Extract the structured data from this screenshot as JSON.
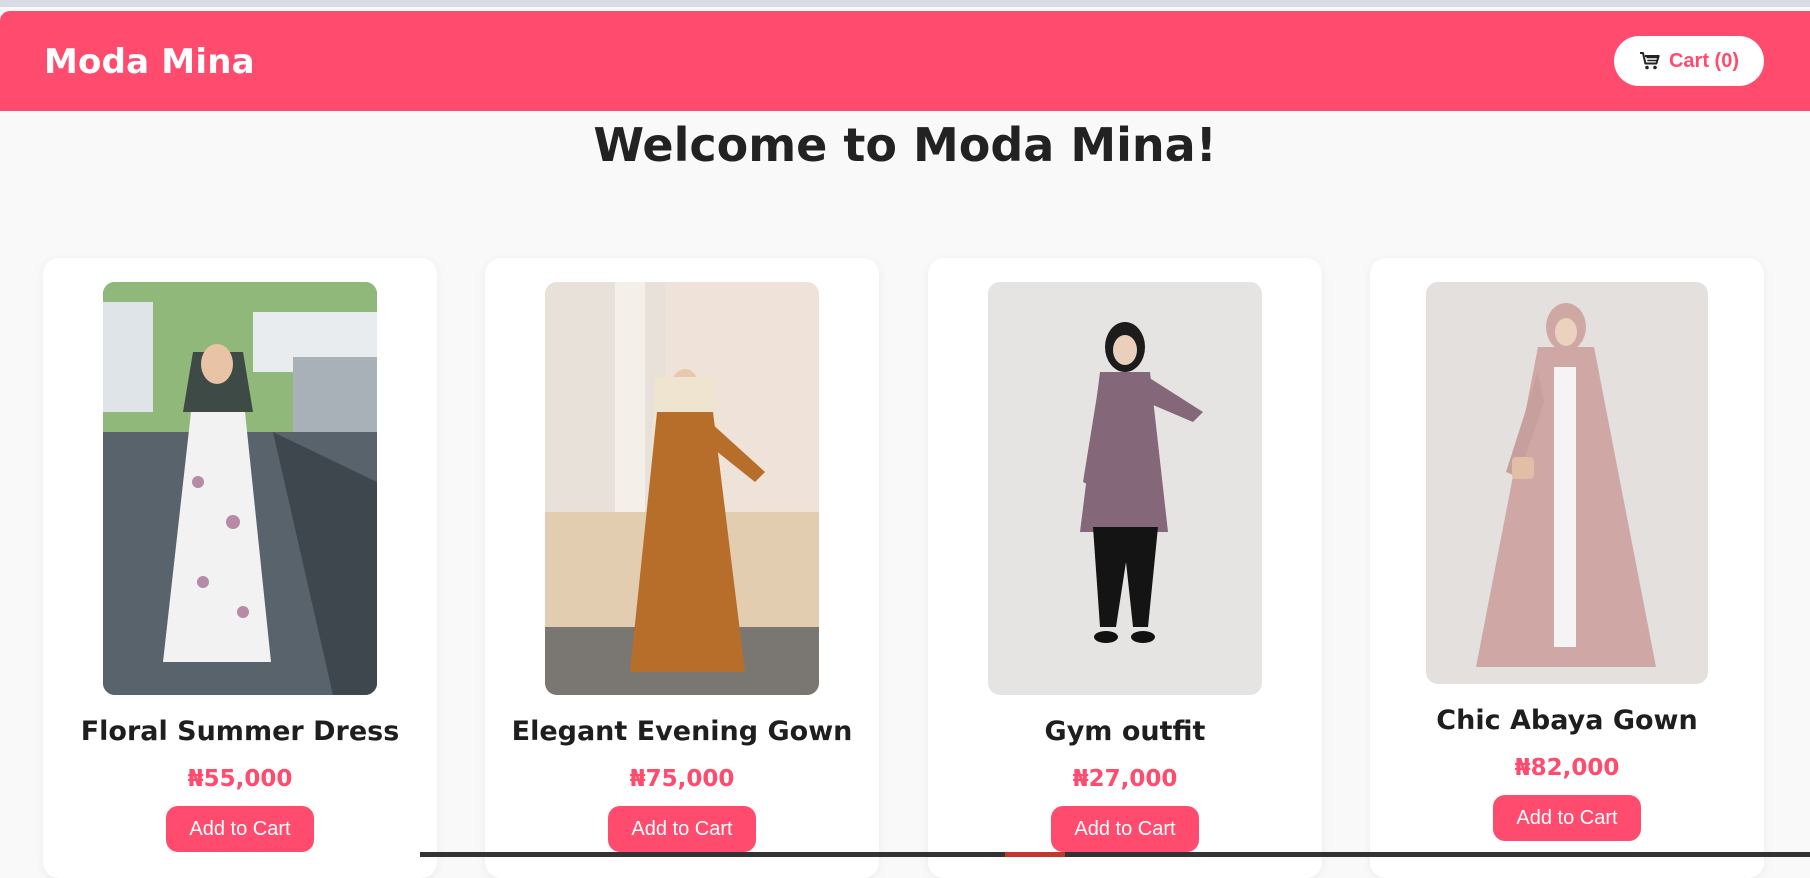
{
  "brand": {
    "name": "Moda Mina"
  },
  "cart": {
    "label": "Cart (0)",
    "icon": "shopping-cart-icon"
  },
  "welcome": {
    "title": "Welcome to Moda Mina!"
  },
  "products": [
    {
      "name": "Floral Summer Dress",
      "price": "₦55,000",
      "button": "Add to Cart"
    },
    {
      "name": "Elegant Evening Gown",
      "price": "₦75,000",
      "button": "Add to Cart"
    },
    {
      "name": "Gym outfit",
      "price": "₦27,000",
      "button": "Add to Cart"
    },
    {
      "name": "Chic Abaya Gown",
      "price": "₦82,000",
      "button": "Add to Cart"
    }
  ],
  "colors": {
    "accent": "#ff4c6e",
    "background": "#f9f9f9",
    "card": "#ffffff"
  }
}
